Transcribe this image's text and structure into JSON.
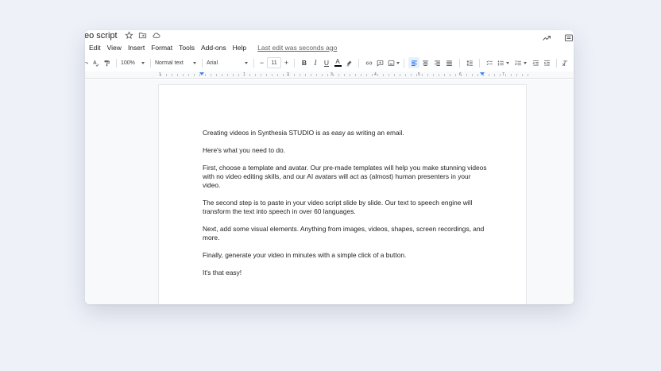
{
  "doc": {
    "title": "eo script",
    "last_edit": "Last edit was seconds ago"
  },
  "menu": [
    "Edit",
    "View",
    "Insert",
    "Format",
    "Tools",
    "Add-ons",
    "Help"
  ],
  "toolbar": {
    "zoom": "100%",
    "style": "Normal text",
    "font": "Arial",
    "font_size": "11",
    "minus": "−",
    "plus": "+",
    "bold": "B",
    "italic": "I",
    "underline": "U",
    "font_color": "A"
  },
  "ruler": {
    "numbers": [
      "1",
      "1",
      "2",
      "3",
      "4",
      "5",
      "6",
      "7"
    ]
  },
  "content": {
    "paragraphs": [
      "Creating videos in Synthesia STUDIO is as easy as writing an email.",
      "Here's what you need to do.",
      "First, choose a template and avatar. Our pre-made templates will help you make stunning videos with no video editing skills, and our AI avatars will act as (almost) human presenters in your video.",
      "The second step is to paste in your video script slide by slide. Our text to speech engine will transform the text into speech in over 60 languages.",
      "Next, add some visual elements. Anything from images, videos, shapes, screen recordings, and more.",
      "Finally, generate your video in minutes with a simple click of a button.",
      "It's that easy!"
    ]
  },
  "icons": {
    "star": "star-icon",
    "folder": "folder-move-icon",
    "cloud": "cloud-status-icon",
    "activity": "trending-icon",
    "comments": "comment-history-icon"
  },
  "colors": {
    "accent": "#1a73e8",
    "background": "#eef1f8",
    "page": "#ffffff"
  }
}
